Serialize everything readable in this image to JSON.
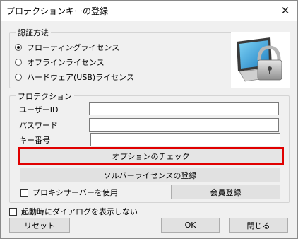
{
  "window": {
    "title": "プロテクションキーの登録",
    "close_glyph": "✕"
  },
  "auth": {
    "group_title": "認証方法",
    "options": [
      {
        "label": "フローティングライセンス",
        "checked": true
      },
      {
        "label": "オフラインライセンス",
        "checked": false
      },
      {
        "label": "ハードウェア(USB)ライセンス",
        "checked": false
      }
    ]
  },
  "protection": {
    "group_title": "プロテクション",
    "user_id_label": "ユーザーID",
    "user_id_value": "",
    "password_label": "パスワード",
    "password_value": "",
    "key_number_label": "キー番号",
    "key_number_value": "",
    "check_options_label": "オプションのチェック",
    "register_solver_label": "ソルバーライセンスの登録",
    "proxy_label": "プロキシサーバーを使用",
    "proxy_checked": false,
    "member_register_label": "会員登録"
  },
  "footer": {
    "no_dialog_label": "起動時にダイアログを表示しない",
    "no_dialog_checked": false,
    "reset_label": "リセット",
    "ok_label": "OK",
    "close_label": "閉じる"
  },
  "colors": {
    "highlight_border": "#e00000",
    "dialog_bg": "#f0f0f0"
  }
}
